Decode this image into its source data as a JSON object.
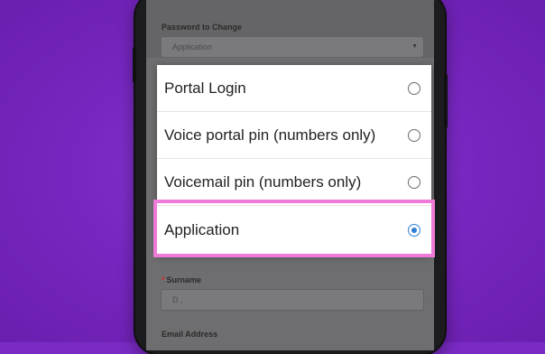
{
  "form": {
    "password_label": "Password to Change",
    "password_value": "Application",
    "surname_label": "Surname",
    "surname_required": "*",
    "surname_value": "D ,",
    "email_label": "Email Address"
  },
  "dialog": {
    "options": [
      {
        "label": "Portal Login",
        "selected": false
      },
      {
        "label": "Voice portal pin (numbers only)",
        "selected": false
      },
      {
        "label": "Voicemail pin (numbers only)",
        "selected": false
      },
      {
        "label": "Application",
        "selected": true
      }
    ]
  },
  "colors": {
    "background": "#7a2bc4",
    "highlight": "#f07ad8",
    "radio_selected": "#2f7fd6"
  }
}
